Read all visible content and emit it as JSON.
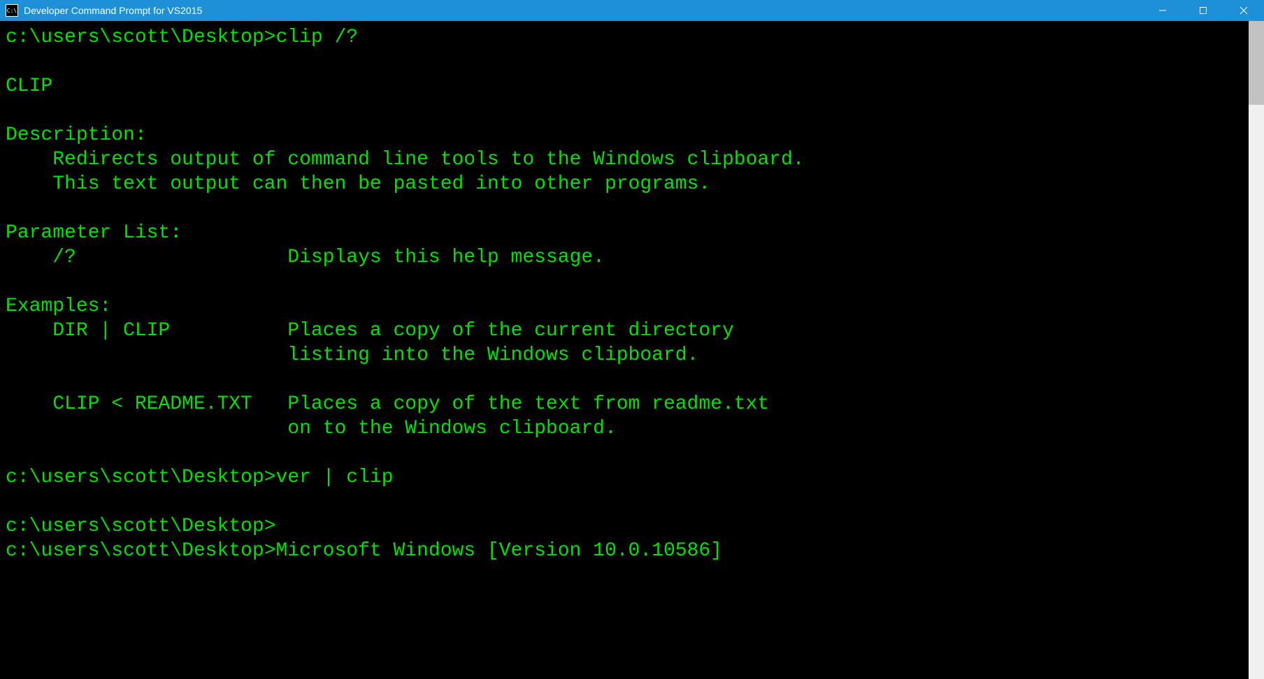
{
  "window": {
    "title": "Developer Command Prompt for VS2015",
    "icon_text": "C:\\"
  },
  "terminal": {
    "lines": [
      "c:\\users\\scott\\Desktop>clip /?",
      "",
      "CLIP",
      "",
      "Description:",
      "    Redirects output of command line tools to the Windows clipboard.",
      "    This text output can then be pasted into other programs.",
      "",
      "Parameter List:",
      "    /?                  Displays this help message.",
      "",
      "Examples:",
      "    DIR | CLIP          Places a copy of the current directory",
      "                        listing into the Windows clipboard.",
      "",
      "    CLIP < README.TXT   Places a copy of the text from readme.txt",
      "                        on to the Windows clipboard.",
      "",
      "c:\\users\\scott\\Desktop>ver | clip",
      "",
      "c:\\users\\scott\\Desktop>",
      "c:\\users\\scott\\Desktop>Microsoft Windows [Version 10.0.10586]"
    ]
  }
}
